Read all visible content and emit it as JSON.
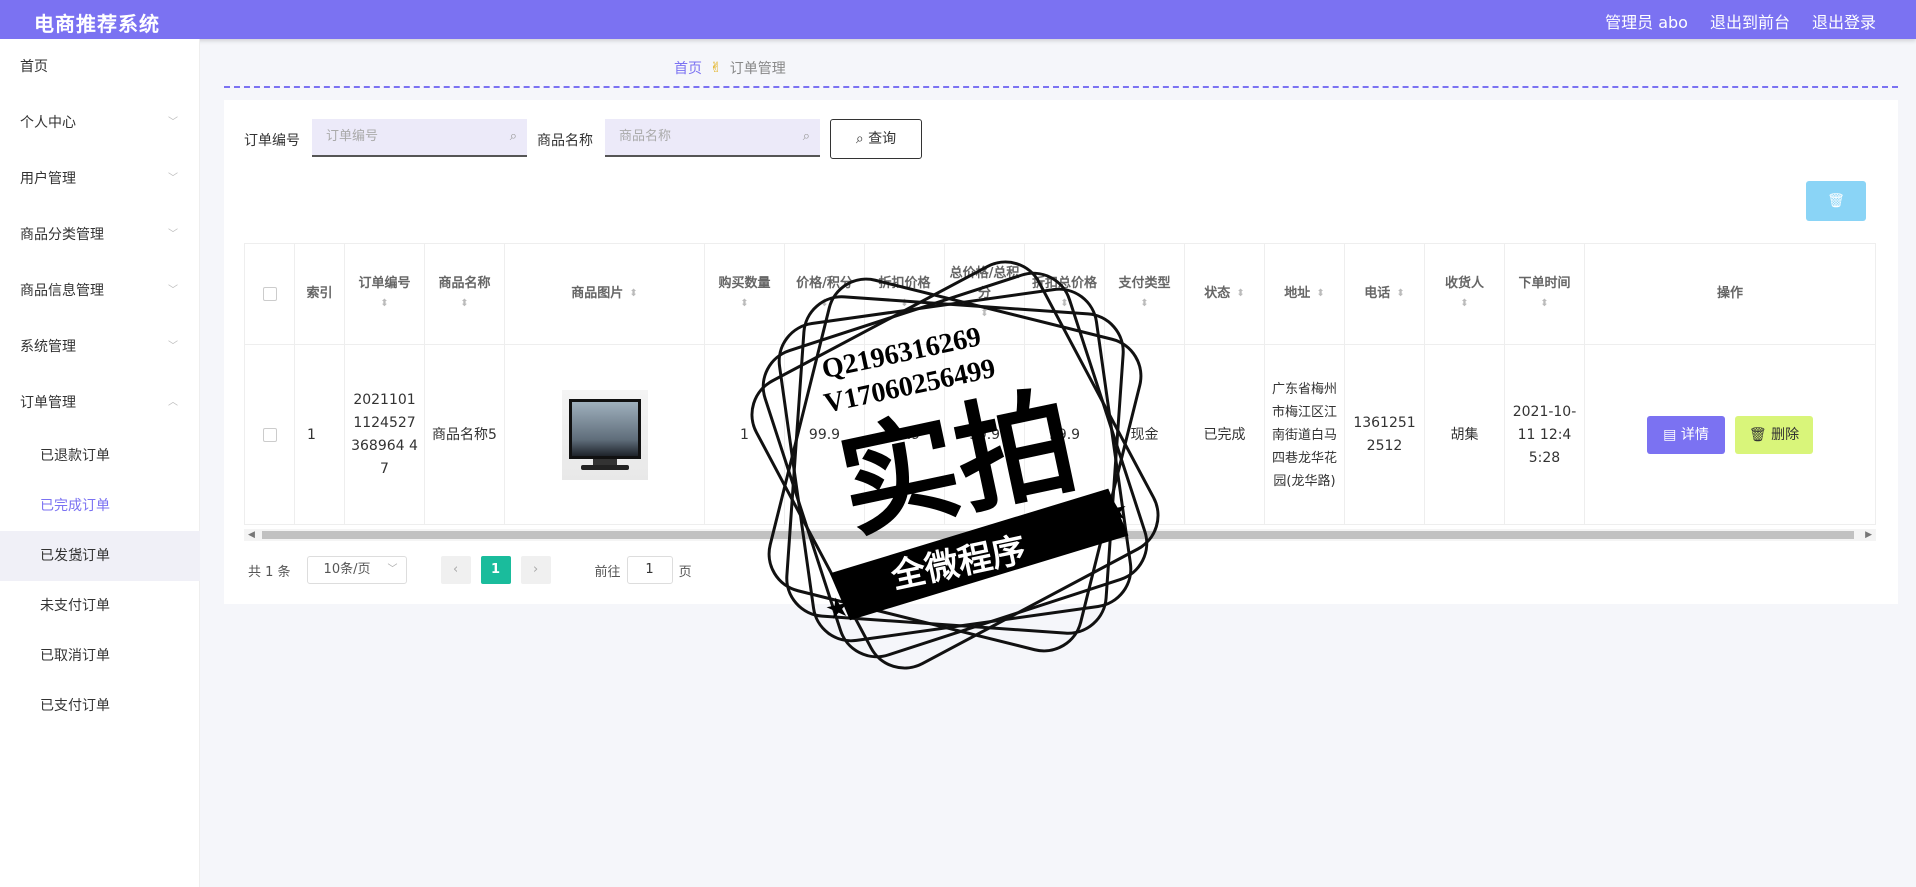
{
  "header": {
    "title": "电商推荐系统",
    "admin_label": "管理员 abo",
    "to_front_label": "退出到前台",
    "logout_label": "退出登录"
  },
  "sidebar": {
    "items": [
      {
        "label": "首页",
        "has_children": false
      },
      {
        "label": "个人中心",
        "has_children": true,
        "expanded": false
      },
      {
        "label": "用户管理",
        "has_children": true,
        "expanded": false
      },
      {
        "label": "商品分类管理",
        "has_children": true,
        "expanded": false
      },
      {
        "label": "商品信息管理",
        "has_children": true,
        "expanded": false
      },
      {
        "label": "系统管理",
        "has_children": true,
        "expanded": false
      },
      {
        "label": "订单管理",
        "has_children": true,
        "expanded": true
      }
    ],
    "order_submenu": [
      {
        "label": "已退款订单"
      },
      {
        "label": "已完成订单",
        "active": true
      },
      {
        "label": "已发货订单",
        "hover": true
      },
      {
        "label": "未支付订单"
      },
      {
        "label": "已取消订单"
      },
      {
        "label": "已支付订单"
      }
    ]
  },
  "breadcrumb": {
    "home": "首页",
    "separator_icon": "hand-icon",
    "current": "订单管理"
  },
  "search": {
    "order_no_label": "订单编号",
    "order_no_placeholder": "订单编号",
    "product_name_label": "商品名称",
    "product_name_placeholder": "商品名称",
    "query_button": "查询"
  },
  "table": {
    "columns": [
      {
        "label": "",
        "sortable": false
      },
      {
        "label": "索引",
        "sortable": false
      },
      {
        "label": "订单编号",
        "sortable": true
      },
      {
        "label": "商品名称",
        "sortable": true
      },
      {
        "label": "商品图片",
        "sortable": true
      },
      {
        "label": "购买数量",
        "sortable": true
      },
      {
        "label": "价格/积分",
        "sortable": true
      },
      {
        "label": "折扣价格",
        "sortable": true
      },
      {
        "label": "总价格/总积分",
        "sortable": true
      },
      {
        "label": "折扣总价格",
        "sortable": true
      },
      {
        "label": "支付类型",
        "sortable": true
      },
      {
        "label": "状态",
        "sortable": true
      },
      {
        "label": "地址",
        "sortable": true
      },
      {
        "label": "电话",
        "sortable": true
      },
      {
        "label": "收货人",
        "sortable": true
      },
      {
        "label": "下单时间",
        "sortable": true
      },
      {
        "label": "操作",
        "sortable": false
      }
    ],
    "rows": [
      {
        "index": "1",
        "order_no": "20211011124527368964 47",
        "product_name": "商品名称5",
        "quantity": "1",
        "price": "99.9",
        "discount_price": "99.9",
        "total_price": "99.9",
        "discount_total": "99.9",
        "payment_type": "现金",
        "status": "已完成",
        "address": "广东省梅州市梅江区江南街道白马四巷龙华花园(龙华路)",
        "phone": "13612512512",
        "receiver": "胡集",
        "order_time": "2021-10-11 12:45:28",
        "detail_button": "详情",
        "delete_button": "删除"
      }
    ]
  },
  "pagination": {
    "total_text": "共 1 条",
    "page_size": "10条/页",
    "current_page": "1",
    "goto_label": "前往",
    "goto_value": "1",
    "page_suffix": "页"
  },
  "watermark": {
    "line1": "Q2196316269",
    "line2": "V17060256499",
    "main": "实拍",
    "banner": "全微程序"
  },
  "colors": {
    "primary": "#7b72f2",
    "page_active": "#1abc9c",
    "delete_btn": "#d9f57a",
    "batch_delete_btn": "#8ad4f6"
  }
}
